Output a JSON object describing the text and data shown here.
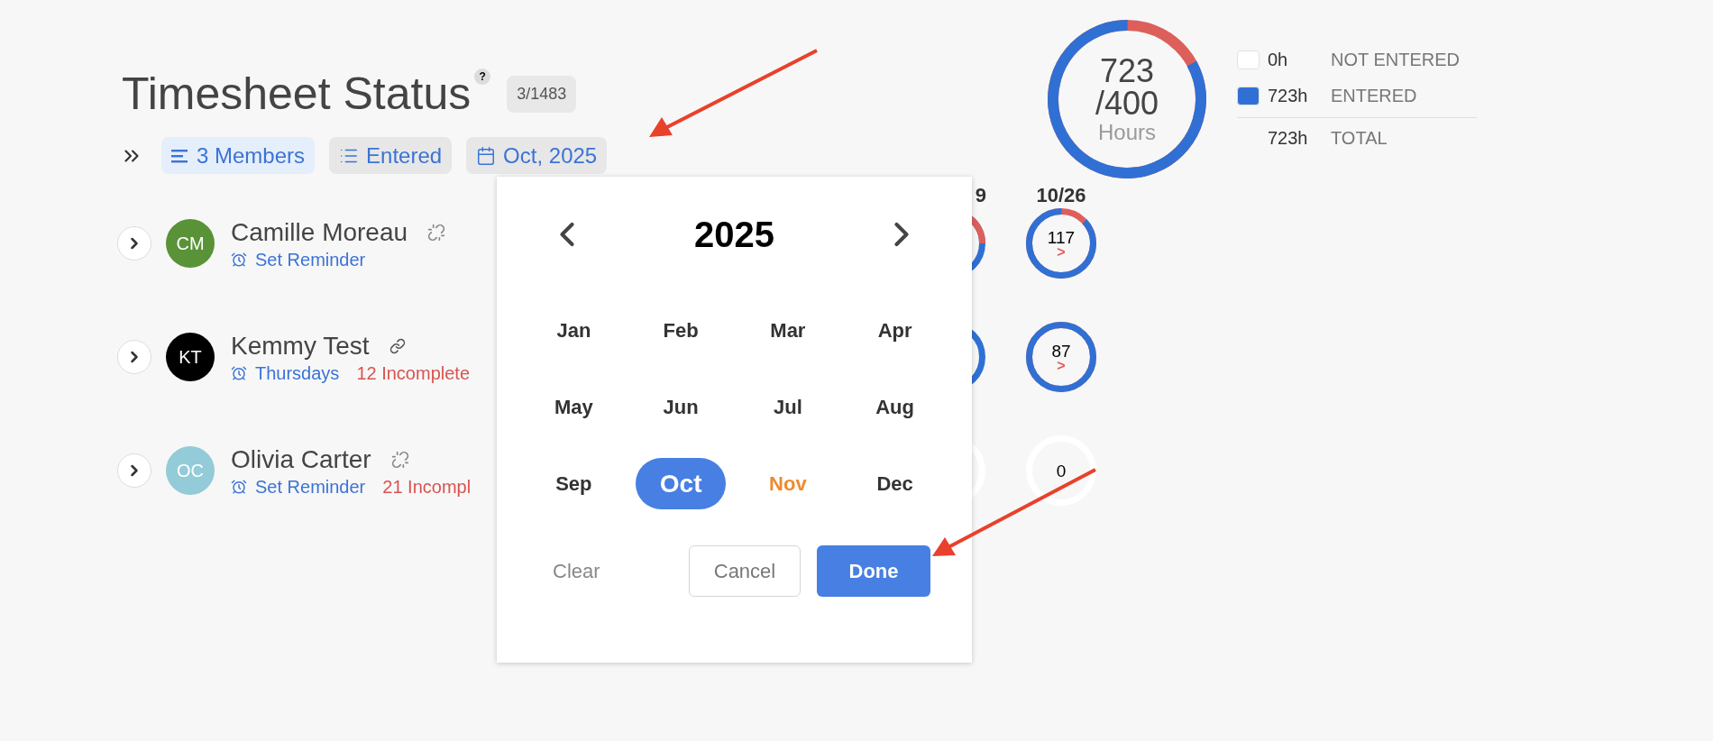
{
  "header": {
    "title": "Timesheet Status",
    "help": "?",
    "count": "3/1483"
  },
  "filters": [
    {
      "kind": "members",
      "label": "3 Members",
      "active": true
    },
    {
      "kind": "list",
      "label": "Entered",
      "active": false
    },
    {
      "kind": "calendar",
      "label": "Oct, 2025",
      "active": false
    }
  ],
  "summary": {
    "value": "723",
    "target": "/400",
    "unit": "Hours",
    "level": 0.83,
    "legend": [
      {
        "color": "#ffffff",
        "value": "0h",
        "label": "NOT ENTERED"
      },
      {
        "color": "#3070d4",
        "value": "723h",
        "label": "ENTERED"
      }
    ],
    "total": {
      "value": "723h",
      "label": "TOTAL"
    }
  },
  "columns": [
    {
      "header": "9"
    },
    {
      "header": "10/26"
    }
  ],
  "members": [
    {
      "initials": "CM",
      "name": "Camille Moreau",
      "color": "#5a9238",
      "linked": false,
      "reminder": "Set Reminder",
      "days": [
        {
          "kind": "over"
        },
        {
          "value": "117",
          "mark": ">",
          "level": 0.87
        }
      ]
    },
    {
      "initials": "KT",
      "name": "Kemmy Test",
      "color": "#000000",
      "linked": true,
      "reminder": "Thursdays",
      "incomplete": "12 Incomplete",
      "days": [
        {
          "kind": "full"
        },
        {
          "value": "87",
          "mark": ">",
          "level": 1
        }
      ]
    },
    {
      "initials": "OC",
      "name": "Olivia Carter",
      "color": "#93cbd8",
      "linked": false,
      "reminder": "Set Reminder",
      "incomplete": "21 Incompl",
      "days": [
        {
          "kind": "empty"
        },
        {
          "value": "0",
          "level": 0
        }
      ]
    }
  ],
  "month_picker": {
    "year": "2025",
    "months": [
      {
        "label": "Jan",
        "selected": false,
        "current": false
      },
      {
        "label": "Feb",
        "selected": false,
        "current": false
      },
      {
        "label": "Mar",
        "selected": false,
        "current": false
      },
      {
        "label": "Apr",
        "selected": false,
        "current": false
      },
      {
        "label": "May",
        "selected": false,
        "current": false
      },
      {
        "label": "Jun",
        "selected": false,
        "current": false
      },
      {
        "label": "Jul",
        "selected": false,
        "current": false
      },
      {
        "label": "Aug",
        "selected": false,
        "current": false
      },
      {
        "label": "Sep",
        "selected": false,
        "current": false
      },
      {
        "label": "Oct",
        "selected": true,
        "current": false
      },
      {
        "label": "Nov",
        "selected": false,
        "current": true
      },
      {
        "label": "Dec",
        "selected": false,
        "current": false
      }
    ],
    "buttons": [
      {
        "kind": "text",
        "label": "Clear"
      },
      {
        "kind": "outline",
        "label": "Cancel"
      },
      {
        "kind": "primary",
        "label": "Done"
      }
    ]
  }
}
